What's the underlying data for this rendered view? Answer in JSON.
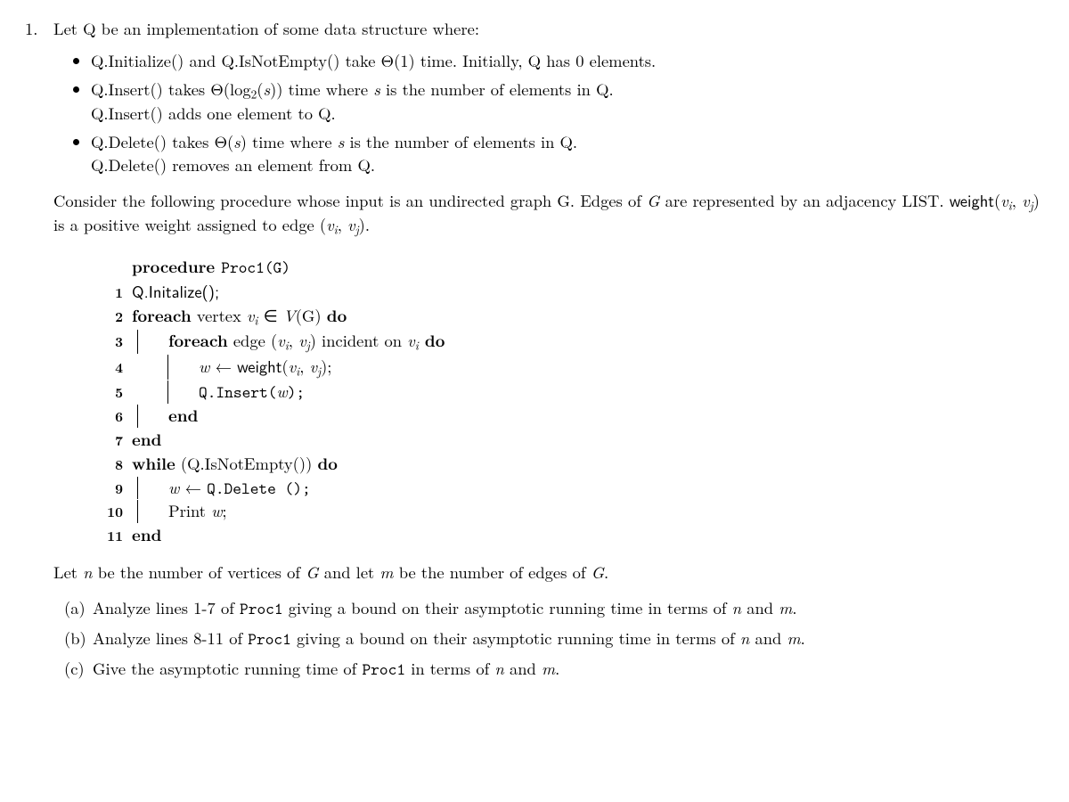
{
  "problem_number": "1.",
  "intro": "Let Q be an implementation of some data structure where:",
  "bullets": {
    "b1": "Q.Initialize() and Q.IsNotEmpty() take Θ(1) time. Initially, Q has 0 elements.",
    "b2_line1_pre": "Q.Insert() takes Θ(log",
    "b2_line1_sub": "2",
    "b2_line1_mid": "(",
    "b2_line1_s": "s",
    "b2_line1_post": ")) time where ",
    "b2_line1_s2": "s",
    "b2_line1_tail": " is the number of elements in Q.",
    "b2_line2": "Q.Insert() adds one element to Q.",
    "b3_line1_pre": "Q.Delete() takes Θ(",
    "b3_line1_s": "s",
    "b3_line1_mid": ") time where ",
    "b3_line1_s2": "s",
    "b3_line1_tail": " is the number of elements in Q.",
    "b3_line2": "Q.Delete() removes an element from Q."
  },
  "para1_a": "Consider the following procedure whose input is an undirected graph G. Edges of ",
  "para1_G": "G",
  "para1_b": " are represented by an adjacency LIST. ",
  "para1_weight": "weight",
  "para1_c": "(",
  "para1_vi": "v",
  "para1_i": "i",
  "para1_comma": ", ",
  "para1_vj": "v",
  "para1_j": "j",
  "para1_d": ") is a positive weight assigned to edge (",
  "para1_vi2": "v",
  "para1_i2": "i",
  "para1_comma2": ", ",
  "para1_vj2": "v",
  "para1_j2": "j",
  "para1_e": ").",
  "alg": {
    "l0_a": "procedure ",
    "l0_b": "Proc1(G)",
    "n1": "1",
    "l1": "Q.Initalize();",
    "n2": "2",
    "l2_a": "foreach",
    "l2_b": " vertex ",
    "l2_vi": "v",
    "l2_i": "i",
    "l2_in": " ∈ ",
    "l2_V": "V",
    "l2_c": "(G) ",
    "l2_do": "do",
    "n3": "3",
    "l3_a": "foreach",
    "l3_b": " edge (",
    "l3_vi": "v",
    "l3_i": "i",
    "l3_comma": ", ",
    "l3_vj": "v",
    "l3_j": "j",
    "l3_c": ") incident on ",
    "l3_vi2": "v",
    "l3_i2": "i",
    "l3_do": " do",
    "n4": "4",
    "l4_w": "w",
    "l4_arrow": " ← ",
    "l4_weight": "weight",
    "l4_a": "(",
    "l4_vi": "v",
    "l4_i": "i",
    "l4_comma": ", ",
    "l4_vj": "v",
    "l4_j": "j",
    "l4_b": ");",
    "n5": "5",
    "l5_a": "Q.Insert(",
    "l5_w": "w",
    "l5_b": ");",
    "n6": "6",
    "l6": "end",
    "n7": "7",
    "l7": "end",
    "n8": "8",
    "l8_a": "while",
    "l8_b": " (Q.IsNotEmpty()) ",
    "l8_do": "do",
    "n9": "9",
    "l9_w": "w",
    "l9_arrow": " ← ",
    "l9_call": "Q.Delete ();",
    "n10": "10",
    "l10_a": "Print ",
    "l10_w": "w",
    "l10_b": ";",
    "n11": "11",
    "l11": "end"
  },
  "para2_a": "Let ",
  "para2_n": "n",
  "para2_b": " be the number of vertices of ",
  "para2_G": "G",
  "para2_c": " and let ",
  "para2_m": "m",
  "para2_d": " be the number of edges of ",
  "para2_G2": "G",
  "para2_e": ".",
  "parts": {
    "a_label": "(a)",
    "a_1": "Analyze lines 1-7 of ",
    "a_proc": "Proc1",
    "a_2": " giving a bound on their asymptotic running time in terms of ",
    "a_n": "n",
    "a_and": " and ",
    "a_m": "m",
    "a_3": ".",
    "b_label": "(b)",
    "b_1": "Analyze lines 8-11 of ",
    "b_proc": "Proc1",
    "b_2": " giving a bound on their asymptotic running time in terms of ",
    "b_n": "n",
    "b_and": " and ",
    "b_m": "m",
    "b_3": ".",
    "c_label": "(c)",
    "c_1": "Give the asymptotic running time of ",
    "c_proc": "Proc1",
    "c_2": " in terms of ",
    "c_n": "n",
    "c_and": " and ",
    "c_m": "m",
    "c_3": "."
  }
}
